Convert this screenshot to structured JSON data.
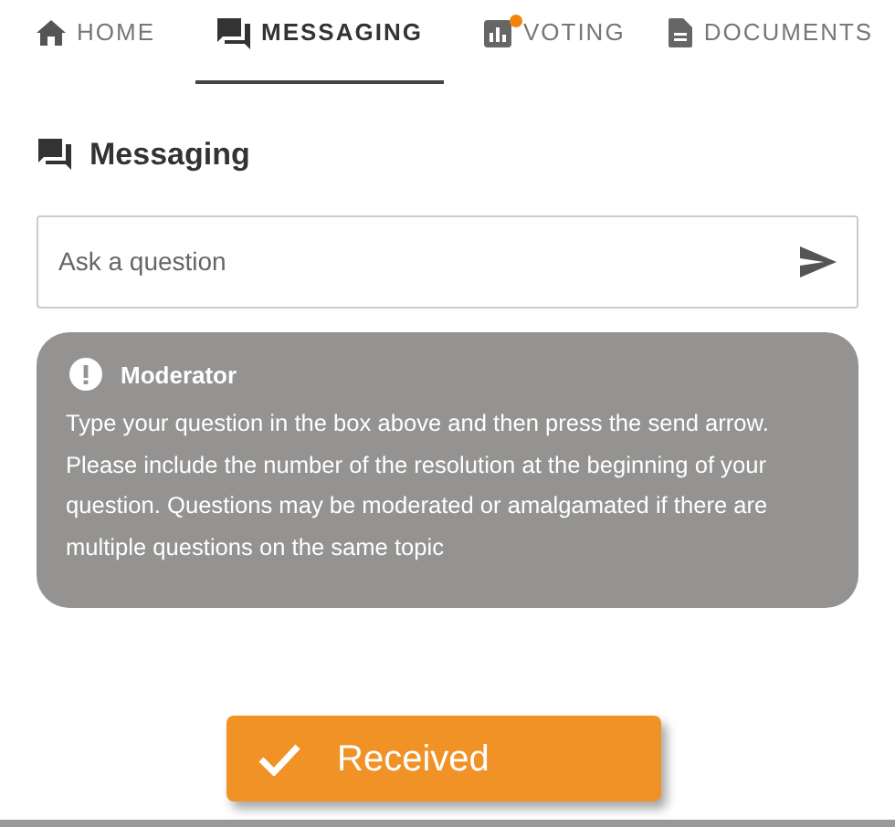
{
  "tabs": [
    {
      "kind": "home",
      "label": "HOME",
      "selected": false,
      "notification": false
    },
    {
      "kind": "messaging",
      "label": "MESSAGING",
      "selected": true,
      "notification": false
    },
    {
      "kind": "voting",
      "label": "VOTING",
      "selected": false,
      "notification": true
    },
    {
      "kind": "documents",
      "label": "DOCUMENTS",
      "selected": false,
      "notification": false
    }
  ],
  "section": {
    "title": "Messaging"
  },
  "question_field": {
    "placeholder": "Ask a question"
  },
  "moderator_note": {
    "title": "Moderator",
    "text": "Type your question in the box above and then press the send arrow. Please include the number of the resolution at the beginning of your question. Questions may be moderated or amalgamated if there are multiple questions on the same topic"
  },
  "toast": {
    "label": "Received"
  }
}
